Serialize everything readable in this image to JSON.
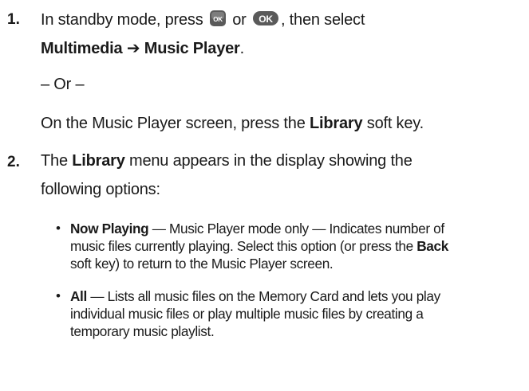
{
  "step1": {
    "number": "1.",
    "intro": "In standby mode, press",
    "or": "or",
    "then_select": ", then select",
    "path_a": "Multimedia",
    "arrow": "➔",
    "path_b": "Music Player",
    "path_end": ".",
    "or_separator": "– Or –",
    "alt_pre": "On the Music Player screen, press the",
    "alt_key": "Library",
    "alt_post": "soft key.",
    "menu_key_label": "OK",
    "ok_key_label": "OK"
  },
  "step2": {
    "number": "2.",
    "pre": "The",
    "menu": "Library",
    "post": "menu appears in the display showing the",
    "line2": "following options:"
  },
  "bullets": [
    {
      "term": "Now Playing",
      "line1_rest": " — Music Player mode only — Indicates number of",
      "line2_pre": "music files currently playing. Select this option (or press the ",
      "line2_key": "Back",
      "line3": "soft key) to return to the Music Player screen."
    },
    {
      "term": "All",
      "line1_rest": " — Lists all music files on the Memory Card and lets you play",
      "line2": "individual music files or play multiple music files by creating a",
      "line3": "temporary music playlist."
    }
  ],
  "colors": {
    "text": "#1a1a1a",
    "key_fill": "#5a5a5a",
    "key_text": "#ffffff"
  }
}
